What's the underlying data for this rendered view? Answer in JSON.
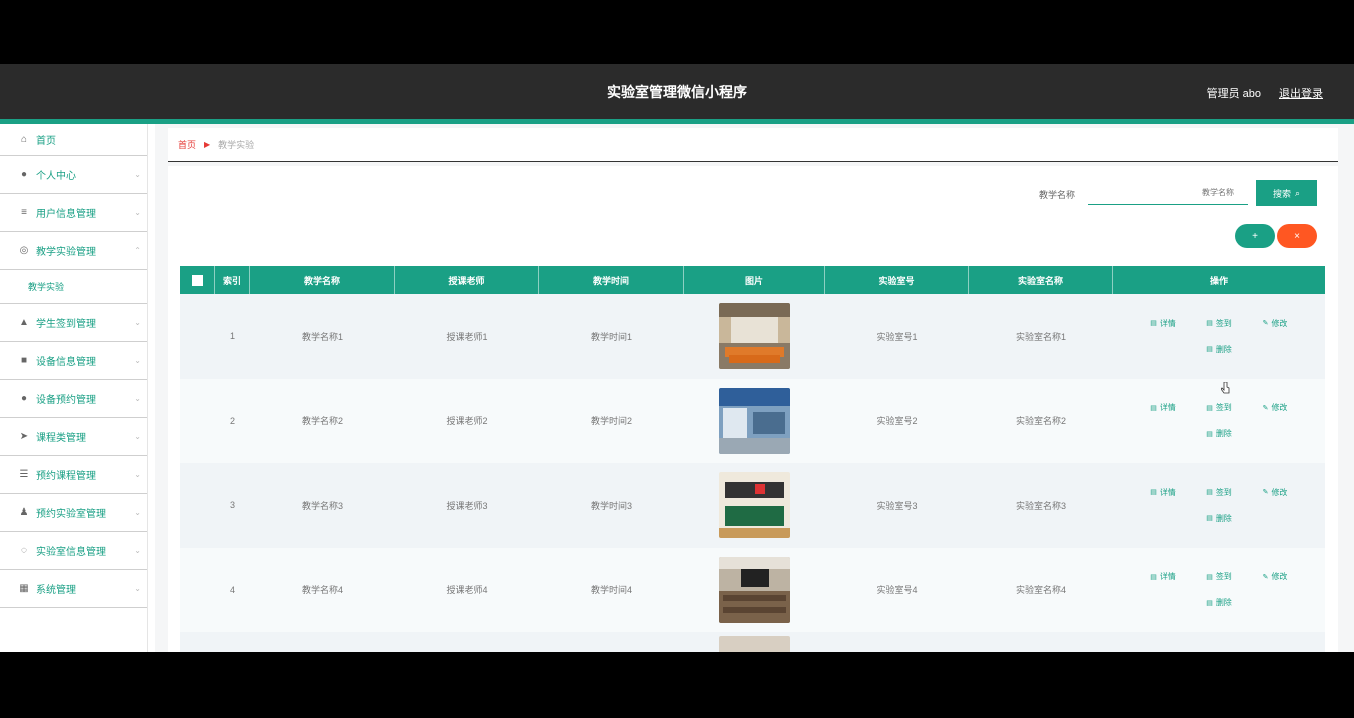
{
  "header": {
    "title": "实验室管理微信小程序",
    "user": "管理员 abo",
    "logout": "退出登录"
  },
  "sidebar": {
    "items": [
      {
        "label": "首页",
        "icon": "home-icon"
      },
      {
        "label": "个人中心",
        "icon": "user-icon"
      },
      {
        "label": "用户信息管理",
        "icon": "list-icon"
      },
      {
        "label": "教学实验管理",
        "icon": "flask-icon"
      },
      {
        "label": "教学实验",
        "sub": true
      },
      {
        "label": "学生签到管理",
        "icon": "hat-icon"
      },
      {
        "label": "设备信息管理",
        "icon": "grid-icon"
      },
      {
        "label": "设备预约管理",
        "icon": "user-icon"
      },
      {
        "label": "课程类管理",
        "icon": "send-icon"
      },
      {
        "label": "预约课程管理",
        "icon": "sliders-icon"
      },
      {
        "label": "预约实验室管理",
        "icon": "person-icon"
      },
      {
        "label": "实验室信息管理",
        "icon": "wifi-icon"
      },
      {
        "label": "系统管理",
        "icon": "grid-icon"
      }
    ]
  },
  "breadcrumb": {
    "home": "首页",
    "current": "教学实验"
  },
  "search": {
    "label": "教学名称",
    "placeholder": "教学名称",
    "button": "搜索"
  },
  "actions": {
    "add": "+",
    "delete": "×"
  },
  "table": {
    "headers": [
      "索引",
      "教学名称",
      "授课老师",
      "教学时间",
      "图片",
      "实验室号",
      "实验室名称",
      "操作"
    ],
    "rows": [
      {
        "index": "1",
        "name": "教学名称1",
        "teacher": "授课老师1",
        "time": "教学时间1",
        "lab_no": "实验室号1",
        "lab_name": "实验室名称1",
        "image": "lab-room-orange-chairs"
      },
      {
        "index": "2",
        "name": "教学名称2",
        "teacher": "授课老师2",
        "time": "教学时间2",
        "lab_no": "实验室号2",
        "lab_name": "实验室名称2",
        "image": "lab-room-blue-ceiling"
      },
      {
        "index": "3",
        "name": "教学名称3",
        "teacher": "授课老师3",
        "time": "教学时间3",
        "lab_no": "实验室号3",
        "lab_name": "实验室名称3",
        "image": "classroom-blackboard"
      },
      {
        "index": "4",
        "name": "教学名称4",
        "teacher": "授课老师4",
        "time": "教学时间4",
        "lab_no": "实验室号4",
        "lab_name": "实验室名称4",
        "image": "classroom-desks"
      }
    ],
    "ops": [
      "详情",
      "签到",
      "修改",
      "删除"
    ]
  },
  "colors": {
    "accent": "#1aa085",
    "danger": "#ff5722",
    "topbar": "#2b2b2b"
  }
}
